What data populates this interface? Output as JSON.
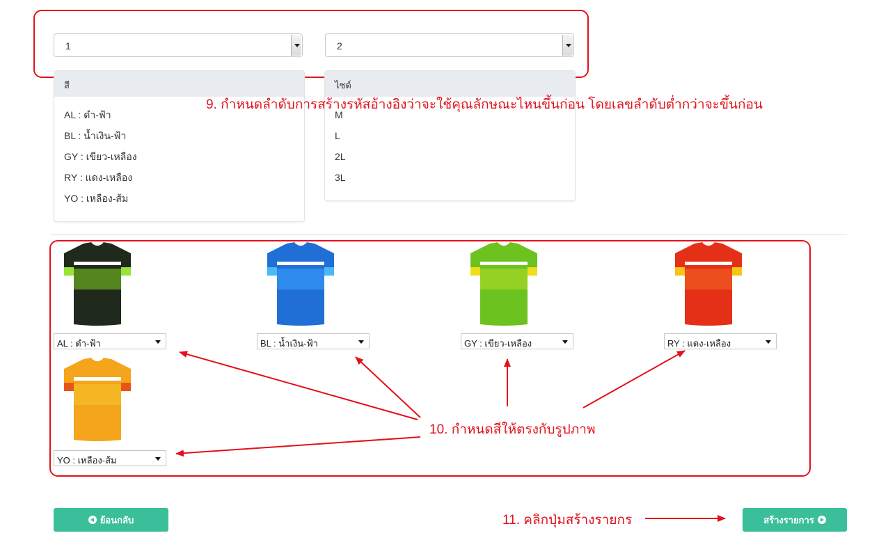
{
  "order": {
    "first": "1",
    "second": "2"
  },
  "color_panel": {
    "header": "สี",
    "items": [
      "AL : ดำ-ฟ้า",
      "BL : น้ำเงิน-ฟ้า",
      "GY : เขียว-เหลือง",
      "RY : แดง-เหลือง",
      "YO : เหลือง-ส้ม"
    ]
  },
  "size_panel": {
    "header": "ไซด์",
    "items": [
      "M",
      "L",
      "2L",
      "3L"
    ]
  },
  "annotations": {
    "step9": "9. กำหนดลำดับการสร้างรหัสอ้างอิงว่าจะใช้คุณลักษณะไหนขึ้นก่อน โดยเลขลำดับต่ำกว่าจะขึ้นก่อน",
    "step10": "10. กำหนดสีให้ตรงกับรูปภาพ",
    "step11": "11. คลิกปุ่มสร้างรายกร",
    "color": "#e3111b"
  },
  "products": [
    {
      "selected": "AL : ดำ-ฟ้า",
      "body": "#1f2a1c",
      "accent": "#7ed321",
      "trim": "#9be23a"
    },
    {
      "selected": "BL : น้ำเงิน-ฟ้า",
      "body": "#1f6fd6",
      "accent": "#3aa0ff",
      "trim": "#49b8f5"
    },
    {
      "selected": "GY : เขียว-เหลือง",
      "body": "#6cc21e",
      "accent": "#b7de2a",
      "trim": "#f2dc1c"
    },
    {
      "selected": "RY : แดง-เหลือง",
      "body": "#e53018",
      "accent": "#f06a22",
      "trim": "#f5c518"
    },
    {
      "selected": "YO : เหลือง-ส้ม",
      "body": "#f4a51c",
      "accent": "#f6c52c",
      "trim": "#e8541a"
    }
  ],
  "buttons": {
    "back": "ย้อนกลับ",
    "create": "สร้างรายการ",
    "color": "#3bbf9a"
  }
}
